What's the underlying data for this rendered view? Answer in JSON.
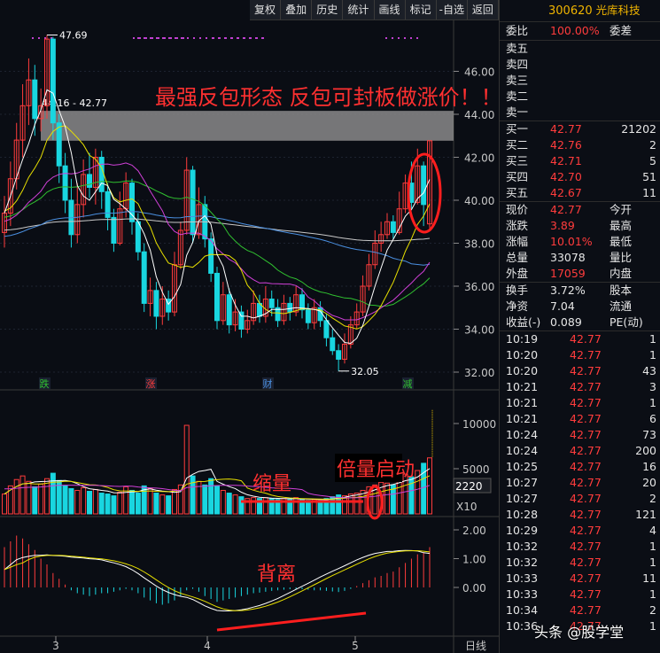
{
  "toolbar": [
    "复权",
    "叠加",
    "历史",
    "统计",
    "画线",
    "标记",
    "-自选",
    "返回"
  ],
  "chart": {
    "y_labels": [
      "46.00",
      "44.00",
      "42.00",
      "40.00",
      "38.00",
      "36.00",
      "34.00",
      "32.00"
    ],
    "vol_labels": [
      "10000",
      "5000"
    ],
    "vol_box": "2220",
    "vol_x10": "X10",
    "macd_labels": [
      "2.00",
      "1.00",
      "0.00"
    ],
    "x_labels": [
      "3",
      "4",
      "5"
    ],
    "x_right": "日线",
    "high_label": "47.69",
    "low_label": "32.05",
    "band_label": "44.16 - 42.77",
    "annot_top": "最强反包形态   反包可封板做涨价！！！",
    "annot_vol1": "缩量",
    "annot_vol2": "倍量启动",
    "annot_macd": "背离",
    "markers": [
      "跌",
      "涨",
      "财",
      "减"
    ],
    "colors": {
      "up": "#ff3c3c",
      "down": "#19d6e0",
      "ma5": "#ffffff",
      "ma10": "#e8e000",
      "ma20": "#d040d8",
      "ma30": "#30c030",
      "ma60": "#4a8fe0",
      "ma120": "#c8c8c8",
      "band": "#8a8a8a"
    }
  },
  "panel": {
    "code": "300620",
    "name": "光库科技",
    "weibi_label": "委比",
    "weibi_value": "100.00%",
    "weicha_label": "委差",
    "sells": [
      {
        "label": "卖五"
      },
      {
        "label": "卖四"
      },
      {
        "label": "卖三"
      },
      {
        "label": "卖二"
      },
      {
        "label": "卖一"
      }
    ],
    "buys": [
      {
        "label": "买一",
        "price": "42.77",
        "vol": "21202"
      },
      {
        "label": "买二",
        "price": "42.76",
        "vol": "2"
      },
      {
        "label": "买三",
        "price": "42.71",
        "vol": "5"
      },
      {
        "label": "买四",
        "price": "42.70",
        "vol": "51"
      },
      {
        "label": "买五",
        "price": "42.67",
        "vol": "11"
      }
    ],
    "stats": [
      {
        "l1": "现价",
        "v1": "42.77",
        "c1": "red",
        "l2": "今开"
      },
      {
        "l1": "涨跌",
        "v1": "3.89",
        "c1": "red",
        "l2": "最高"
      },
      {
        "l1": "涨幅",
        "v1": "10.01%",
        "c1": "red",
        "l2": "最低"
      },
      {
        "l1": "总量",
        "v1": "33078",
        "c1": "white",
        "l2": "量比"
      },
      {
        "l1": "外盘",
        "v1": "17059",
        "c1": "red",
        "l2": "内盘"
      }
    ],
    "stats2": [
      {
        "l1": "换手",
        "v1": "3.72%",
        "l2": "股本"
      },
      {
        "l1": "净资",
        "v1": "7.04",
        "l2": "流通"
      },
      {
        "l1": "收益(-)",
        "v1": "0.089",
        "l2": "PE(动)"
      }
    ],
    "ticks": [
      {
        "t": "10:19",
        "p": "42.77",
        "v": "1"
      },
      {
        "t": "10:20",
        "p": "42.77",
        "v": "1"
      },
      {
        "t": "10:20",
        "p": "42.77",
        "v": "43"
      },
      {
        "t": "10:21",
        "p": "42.77",
        "v": "3"
      },
      {
        "t": "10:21",
        "p": "42.77",
        "v": "1"
      },
      {
        "t": "10:21",
        "p": "42.77",
        "v": "6"
      },
      {
        "t": "10:24",
        "p": "42.77",
        "v": "73"
      },
      {
        "t": "10:24",
        "p": "42.77",
        "v": "200"
      },
      {
        "t": "10:25",
        "p": "42.77",
        "v": "16"
      },
      {
        "t": "10:27",
        "p": "42.77",
        "v": "20"
      },
      {
        "t": "10:27",
        "p": "42.77",
        "v": "2"
      },
      {
        "t": "10:28",
        "p": "42.77",
        "v": "121"
      },
      {
        "t": "10:29",
        "p": "42.77",
        "v": "4"
      },
      {
        "t": "10:32",
        "p": "42.77",
        "v": "1"
      },
      {
        "t": "10:32",
        "p": "42.77",
        "v": "1"
      },
      {
        "t": "10:33",
        "p": "42.77",
        "v": "11"
      },
      {
        "t": "10:33",
        "p": "42.77",
        "v": "1"
      },
      {
        "t": "10:34",
        "p": "42.77",
        "v": "2"
      },
      {
        "t": "10:36",
        "p": "42.77",
        "v": "1"
      }
    ]
  },
  "watermark": "头条 @股学堂"
}
